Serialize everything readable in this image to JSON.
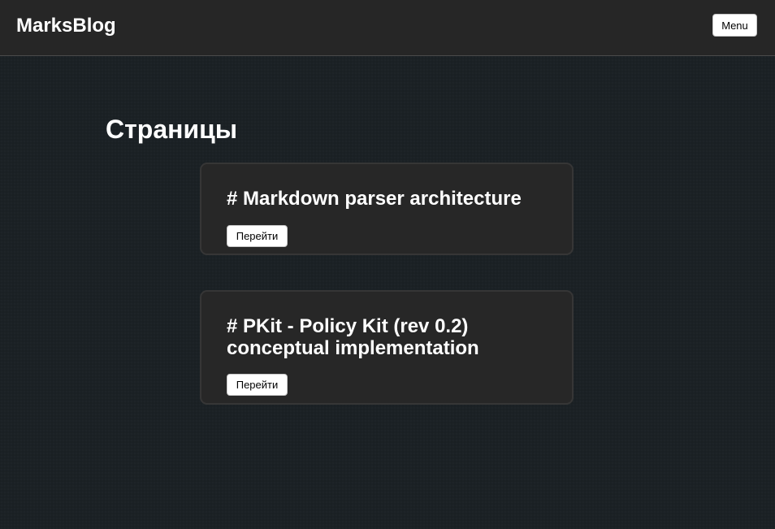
{
  "header": {
    "brand": "MarksBlog",
    "menu_label": "Menu"
  },
  "main": {
    "heading": "Страницы",
    "cards": [
      {
        "title": "# Markdown parser architecture",
        "button_label": "Перейти"
      },
      {
        "title": "# PKit - Policy Kit (rev 0.2) conceptual implementation",
        "button_label": "Перейти"
      }
    ]
  },
  "colors": {
    "background": "#1b2125",
    "header_background": "#262626",
    "card_background": "#272727",
    "card_border": "#363636",
    "text": "#ffffff",
    "button_background": "#ffffff",
    "button_text": "#000000"
  }
}
